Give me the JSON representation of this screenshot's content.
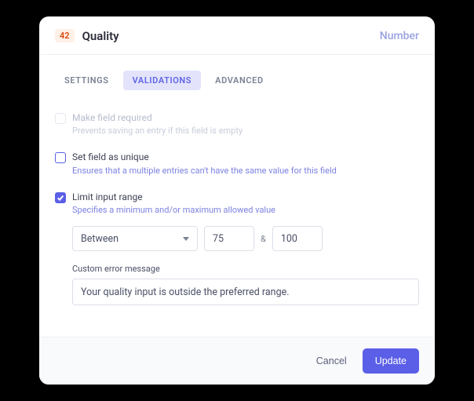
{
  "header": {
    "badge": "42",
    "title": "Quality",
    "type": "Number"
  },
  "tabs": {
    "settings": "SETTINGS",
    "validations": "VALIDATIONS",
    "advanced": "ADVANCED"
  },
  "options": {
    "required": {
      "label": "Make field required",
      "desc": "Prevents saving an entry if this field is empty"
    },
    "unique": {
      "label": "Set field as unique",
      "desc": "Ensures that a multiple entries can't have the same value for this field"
    },
    "range": {
      "label": "Limit input range",
      "desc": "Specifies a minimum and/or maximum allowed value"
    }
  },
  "range": {
    "mode": "Between",
    "min": "75",
    "sep": "&",
    "max": "100",
    "error_label": "Custom error message",
    "error_value": "Your quality input is outside the preferred range."
  },
  "footer": {
    "cancel": "Cancel",
    "update": "Update"
  }
}
